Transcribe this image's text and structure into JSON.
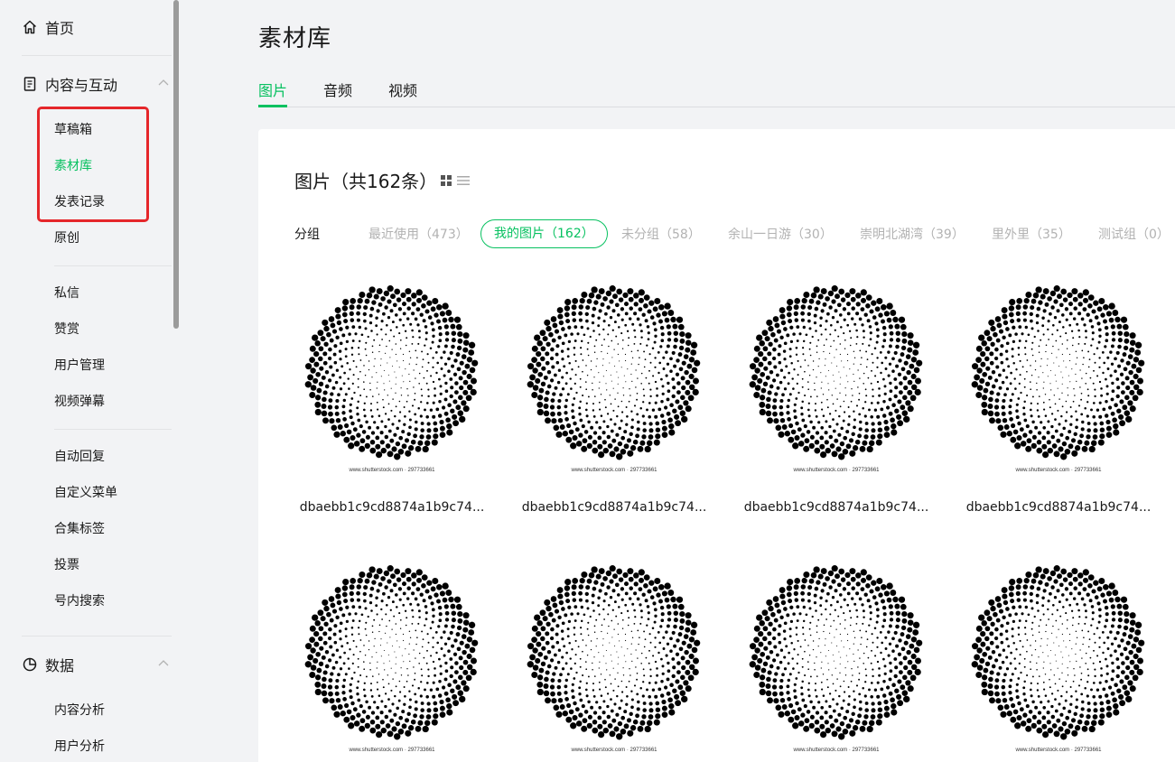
{
  "sidebar": {
    "home": {
      "label": "首页",
      "icon": "home-icon"
    },
    "content_group": {
      "label": "内容与互动",
      "icon": "document-icon"
    },
    "content_items": [
      {
        "label": "草稿箱"
      },
      {
        "label": "素材库",
        "active": true
      },
      {
        "label": "发表记录"
      },
      {
        "label": "原创"
      }
    ],
    "interaction_items": [
      {
        "label": "私信"
      },
      {
        "label": "赞赏"
      },
      {
        "label": "用户管理"
      },
      {
        "label": "视频弹幕"
      }
    ],
    "feature_items": [
      {
        "label": "自动回复"
      },
      {
        "label": "自定义菜单"
      },
      {
        "label": "合集标签"
      },
      {
        "label": "投票"
      },
      {
        "label": "号内搜索"
      }
    ],
    "data_group": {
      "label": "数据",
      "icon": "pie-chart-icon"
    },
    "data_items": [
      {
        "label": "内容分析"
      },
      {
        "label": "用户分析"
      }
    ]
  },
  "page": {
    "title": "素材库",
    "tabs": [
      {
        "label": "图片",
        "active": true
      },
      {
        "label": "音频"
      },
      {
        "label": "视频"
      }
    ]
  },
  "panel": {
    "title": "图片（共162条）",
    "group_label": "分组",
    "groups": [
      {
        "label": "最近使用（473）"
      },
      {
        "label": "我的图片（162）",
        "active": true
      },
      {
        "label": "未分组（58）"
      },
      {
        "label": "余山一日游（30）"
      },
      {
        "label": "崇明北湖湾（39）"
      },
      {
        "label": "里外里（35）"
      },
      {
        "label": "测试组（0）"
      }
    ],
    "images": [
      {
        "name": "dbaebb1c9cd8874a1b9c74...",
        "watermark": "www.shutterstock.com · 297733661"
      },
      {
        "name": "dbaebb1c9cd8874a1b9c74...",
        "watermark": "www.shutterstock.com · 297733661"
      },
      {
        "name": "dbaebb1c9cd8874a1b9c74...",
        "watermark": "www.shutterstock.com · 297733661"
      },
      {
        "name": "dbaebb1c9cd8874a1b9c74...",
        "watermark": "www.shutterstock.com · 297733661"
      },
      {
        "watermark": "www.shutterstock.com · 297733661"
      },
      {
        "watermark": "www.shutterstock.com · 297733661"
      },
      {
        "watermark": "www.shutterstock.com · 297733661"
      },
      {
        "watermark": "www.shutterstock.com · 297733661"
      }
    ]
  },
  "colors": {
    "accent": "#07c160",
    "highlight": "#e5262a"
  }
}
